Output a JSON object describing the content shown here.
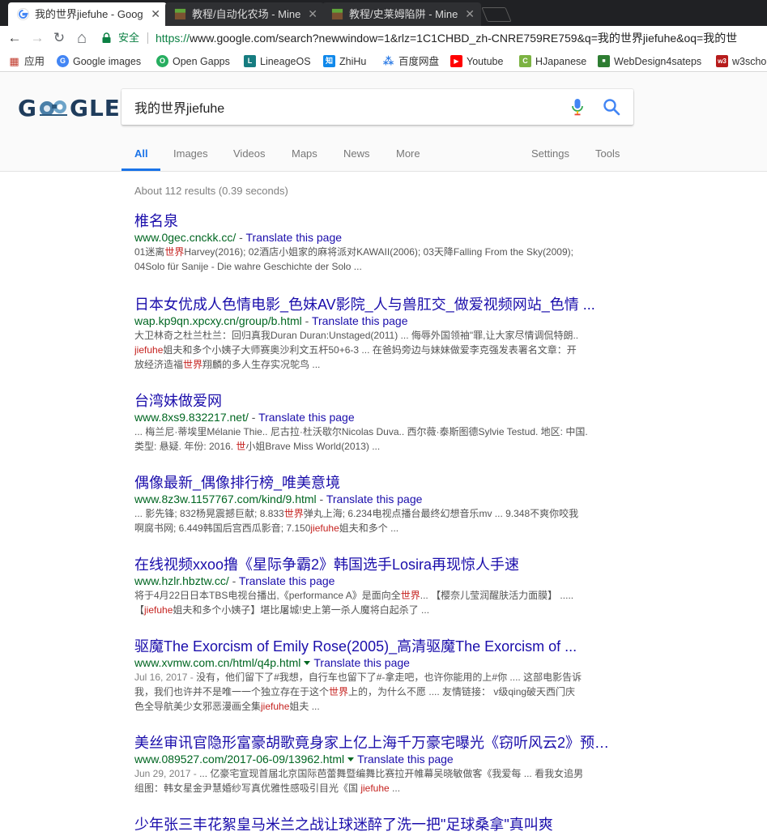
{
  "browser": {
    "tabs": [
      {
        "title": "我的世界jiefuhe - Goog"
      },
      {
        "title": "教程/自动化农场 - Mine"
      },
      {
        "title": "教程/史莱姆陷阱 - Mine"
      }
    ],
    "close_glyph": "✕",
    "address": {
      "secure_label": "安全",
      "scheme": "https://",
      "url_rest": "www.google.com/search?newwindow=1&rlz=1C1CHBD_zh-CNRE759RE759&q=我的世界jiefuhe&oq=我的世"
    },
    "nav_glyphs": {
      "back": "←",
      "forward": "→",
      "reload": "↻",
      "home": "⌂"
    }
  },
  "bookmarks": [
    {
      "label": "应用",
      "color": "#444444",
      "glyph": "▦"
    },
    {
      "label": "Google images",
      "color": "#4285f4",
      "glyph": "G"
    },
    {
      "label": "Open Gapps",
      "color": "#27ae60",
      "glyph": "O"
    },
    {
      "label": "LineageOS",
      "color": "#167c80",
      "glyph": "L"
    },
    {
      "label": "ZhiHu",
      "color": "#0f88eb",
      "glyph": "知"
    },
    {
      "label": "百度网盘",
      "color": "#2d7be5",
      "glyph": "⁂"
    },
    {
      "label": "Youtube",
      "color": "#ff0000",
      "glyph": "▶"
    },
    {
      "label": "HJapanese",
      "color": "#7cb342",
      "glyph": "C"
    },
    {
      "label": "WebDesign4sateps",
      "color": "#2e7d32",
      "glyph": "■"
    },
    {
      "label": "w3scho",
      "color": "#b71c1c",
      "glyph": "w3"
    }
  ],
  "search": {
    "logo": {
      "left": "G",
      "right": "GLE"
    },
    "query": "我的世界jiefuhe",
    "tabs": [
      "All",
      "Images",
      "Videos",
      "Maps",
      "News",
      "More"
    ],
    "tools": [
      "Settings",
      "Tools"
    ],
    "stats": "About 112 results (0.39 seconds)"
  },
  "results": [
    {
      "title": "椎名泉",
      "url": "www.0gec.cnckk.cc/",
      "translate": "Translate this page",
      "snippet": [
        [
          {
            "t": "01迷离"
          },
          {
            "t": "世界",
            "h": true
          },
          {
            "t": "Harvey(2016); 02酒店小姐家的麻将派对KAWAII(2006); 03天降Falling From the Sky(2009);"
          }
        ],
        [
          {
            "t": "04Solo für Sanije - Die wahre Geschichte der Solo ..."
          }
        ]
      ]
    },
    {
      "title": "日本女优成人色情电影_色妹AV影院_人与兽肛交_做爱视频网站_色情 ...",
      "url": "wap.kp9qn.xpcxy.cn/group/b.html",
      "translate": "Translate this page",
      "snippet": [
        [
          {
            "t": "大卫林奇之杜兰杜兰：回归真我Duran Duran:Unstaged(2011) ... 侮辱外国领袖\"罪,让大家尽情调侃特朗.."
          }
        ],
        [
          {
            "t": "jiefuhe",
            "h": true
          },
          {
            "t": "姐夫和多个小姨子大师赛奥沙利文五杆50+6-3 ... 在爸妈旁边与妹妹做爱李克强发表署名文章：开"
          }
        ],
        [
          {
            "t": "放经济造福"
          },
          {
            "t": "世界",
            "h": true
          },
          {
            "t": "翔麟的多人生存实况鸵鸟 ..."
          }
        ]
      ]
    },
    {
      "title": "台湾妹做爱网",
      "url": "www.8xs9.832217.net/",
      "translate": "Translate this page",
      "snippet": [
        [
          {
            "t": "... 梅兰尼·蒂埃里Mélanie Thie.. 尼古拉·杜沃歇尔Nicolas Duva.. 西尔薇·泰斯图德Sylvie Testud. 地区: 中国."
          }
        ],
        [
          {
            "t": "类型: 悬疑. 年份: 2016. "
          },
          {
            "t": "世",
            "h": true
          },
          {
            "t": "小姐Brave Miss World(2013) ..."
          }
        ]
      ]
    },
    {
      "title": "偶像最新_偶像排行榜_唯美意境",
      "url": "www.8z3w.1157767.com/kind/9.html",
      "translate": "Translate this page",
      "snippet": [
        [
          {
            "t": "... 影先锋; 832杨晃震撼巨献; 8.833"
          },
          {
            "t": "世界",
            "h": true
          },
          {
            "t": "弹丸上海; 6.234电视点播台最终幻想音乐mv ... 9.348不爽你咬我"
          }
        ],
        [
          {
            "t": "啊腐书网; 6.449韩国后宫西瓜影音; 7.150"
          },
          {
            "t": "jiefuhe",
            "h": true
          },
          {
            "t": "姐夫和多个 ..."
          }
        ]
      ]
    },
    {
      "title": "在线视频xxoo撸《星际争霸2》韩国选手Losira再现惊人手速",
      "url": "www.hzlr.hbztw.cc/",
      "translate": "Translate this page",
      "snippet": [
        [
          {
            "t": "将于4月22日日本TBS电视台播出,《performance A》是面向全"
          },
          {
            "t": "世界",
            "h": true
          },
          {
            "t": "... 【樱奈儿莹润醒肤活力面膜】 ....."
          }
        ],
        [
          {
            "t": "【"
          },
          {
            "t": "jiefuhe",
            "h": true
          },
          {
            "t": "姐夫和多个小姨子】堪比屠城!史上第一杀人魔将白起杀了 ..."
          }
        ]
      ]
    },
    {
      "title": "驱魔The Exorcism of Emily Rose(2005)_高清驱魔The Exorcism of ...",
      "url": "www.xvmw.com.cn/html/q4p.html",
      "translate": "Translate this page",
      "arrow": true,
      "date": "Jul 16, 2017 - ",
      "snippet": [
        [
          {
            "t": "没有，他们留下了#我想，自行车也留下了#-拿走吧，也许你能用的上#你 .... 这部电影告诉"
          }
        ],
        [
          {
            "t": "我，我们也许并不是唯一一个独立存在于这个"
          },
          {
            "t": "世界",
            "h": true
          },
          {
            "t": "上的，为什么不愿 .... 友情链接： v级qing破天西门庆"
          }
        ],
        [
          {
            "t": "色全导航美少女邪恶漫画全集"
          },
          {
            "t": "jiefuhe",
            "h": true
          },
          {
            "t": "姐夫 ..."
          }
        ]
      ]
    },
    {
      "title": "美丝审讯官隐形富豪胡歌竟身家上亿上海千万豪宅曝光《窃听风云2》预告...",
      "url": "www.089527.com/2017-06-09/13962.html",
      "translate": "Translate this page",
      "arrow": true,
      "date": "Jun 29, 2017 - ",
      "snippet": [
        [
          {
            "t": "... 亿豪宅宣现首届北京国际芭蕾舞暨编舞比赛拉开帷幕吴晓敏做客《我爱每 ... 看我女追男"
          }
        ],
        [
          {
            "t": "组图：韩女星金尹慧婚纱写真优雅性感吸引目光《国 "
          },
          {
            "t": "jiefuhe",
            "h": true
          },
          {
            "t": " ..."
          }
        ]
      ]
    },
    {
      "title": "少年张三丰花絮皇马米兰之战让球迷醉了洗一把\"足球桑拿\"真叫爽",
      "url": "",
      "translate": "",
      "snippet": []
    }
  ]
}
